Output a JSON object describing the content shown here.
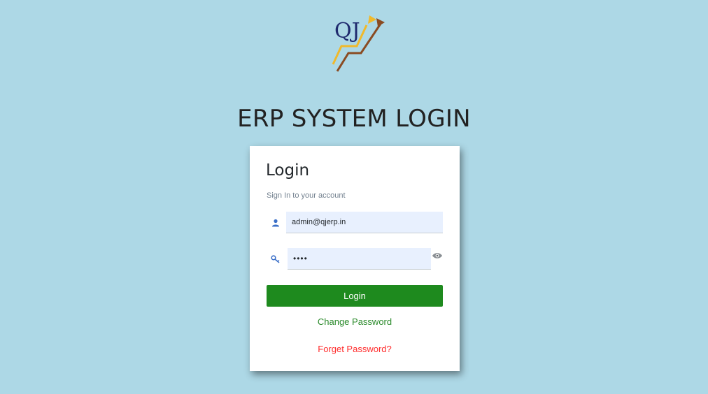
{
  "logo": {
    "text": "QJ"
  },
  "page": {
    "title": "ERP SYSTEM LOGIN"
  },
  "login_card": {
    "title": "Login",
    "subtitle": "Sign In to your account",
    "username": {
      "value": "admin@qjerp.in",
      "icon": "user-icon"
    },
    "password": {
      "value": "••••",
      "icon": "key-icon",
      "toggle_icon": "eye-icon"
    },
    "login_label": "Login",
    "change_password_label": "Change Password",
    "forget_password_label": "Forget Password?"
  },
  "colors": {
    "background": "#add8e6",
    "login_button": "#1e8a1e",
    "change_link": "#2a8a2a",
    "forget_link": "#ff2d2d"
  }
}
